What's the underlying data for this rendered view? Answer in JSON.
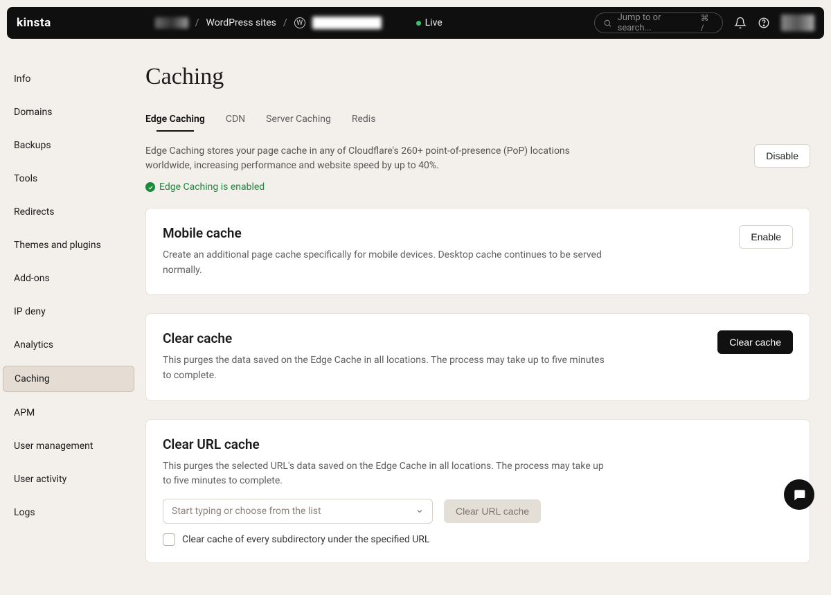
{
  "header": {
    "logo": "kinsta",
    "breadcrumb_label": "WordPress sites",
    "env_label": "Live",
    "search_placeholder": "Jump to or search...",
    "search_shortcut": "⌘ /"
  },
  "sidebar": {
    "items": [
      {
        "label": "Info"
      },
      {
        "label": "Domains"
      },
      {
        "label": "Backups"
      },
      {
        "label": "Tools"
      },
      {
        "label": "Redirects"
      },
      {
        "label": "Themes and plugins"
      },
      {
        "label": "Add-ons"
      },
      {
        "label": "IP deny"
      },
      {
        "label": "Analytics"
      },
      {
        "label": "Caching"
      },
      {
        "label": "APM"
      },
      {
        "label": "User management"
      },
      {
        "label": "User activity"
      },
      {
        "label": "Logs"
      }
    ],
    "active_index": 9
  },
  "page": {
    "title": "Caching",
    "tabs": [
      "Edge Caching",
      "CDN",
      "Server Caching",
      "Redis"
    ],
    "active_tab": 0,
    "intro": "Edge Caching stores your page cache in any of Cloudflare's 260+ point-of-presence (PoP) locations worldwide, increasing performance and website speed by up to 40%.",
    "status": "Edge Caching is enabled",
    "disable_button": "Disable"
  },
  "mobile": {
    "title": "Mobile cache",
    "desc": "Create an additional page cache specifically for mobile devices. Desktop cache continues to be served normally.",
    "button": "Enable"
  },
  "clear": {
    "title": "Clear cache",
    "desc": "This purges the data saved on the Edge Cache in all locations. The process may take up to five minutes to complete.",
    "button": "Clear cache"
  },
  "clear_url": {
    "title": "Clear URL cache",
    "desc": "This purges the selected URL's data saved on the Edge Cache in all locations. The process may take up to five minutes to complete.",
    "placeholder": "Start typing or choose from the list",
    "button": "Clear URL cache",
    "checkbox_label": "Clear cache of every subdirectory under the specified URL"
  }
}
